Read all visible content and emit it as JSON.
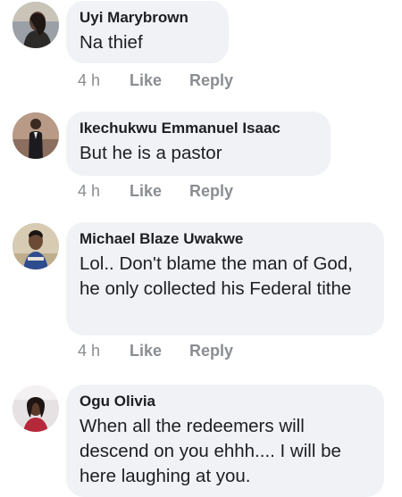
{
  "comments": [
    {
      "author": "Uyi Marybrown",
      "text": "Na thief",
      "time": "4 h",
      "like_label": "Like",
      "reply_label": "Reply"
    },
    {
      "author": "Ikechukwu Emmanuel Isaac",
      "text": "But he is a pastor",
      "time": "4 h",
      "like_label": "Like",
      "reply_label": "Reply"
    },
    {
      "author": "Michael Blaze Uwakwe",
      "text": "Lol.. Don't blame the man of God, he only collected his Federal tithe",
      "time": "4 h",
      "like_label": "Like",
      "reply_label": "Reply"
    },
    {
      "author": "Ogu Olivia",
      "text": "When all the redeemers will descend on you ehhh.... I will be here laughing at you."
    }
  ],
  "colors": {
    "bubble": "#f0f2f5",
    "meta": "#8a8d91",
    "text": "#1c1e21"
  }
}
